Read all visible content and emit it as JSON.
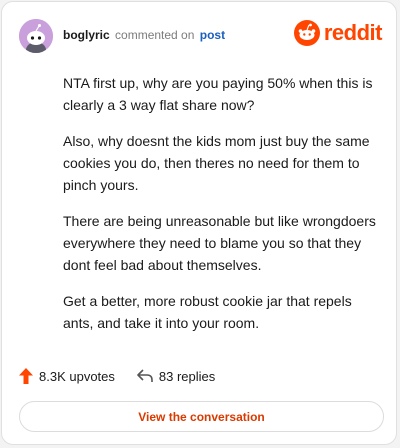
{
  "header": {
    "username": "boglyric",
    "action": "commented on",
    "post_link": "post"
  },
  "logo": {
    "text": "reddit",
    "icon": "reddit-snoo-icon",
    "color": "#ff4500"
  },
  "comment": {
    "paragraphs": [
      "NTA first up, why are you paying 50% when this is clearly a 3 way flat share now?",
      "Also, why doesnt the kids mom just buy the same cookies you do, then theres no need for them to pinch yours.",
      "There are being unreasonable but like wrongdoers everywhere they need to blame you so that they dont feel bad about themselves.",
      "Get a better, more robust cookie jar that repels ants, and take it into your room."
    ]
  },
  "stats": {
    "upvotes": "8.3K upvotes",
    "upvote_icon": "upvote-arrow-icon",
    "replies": "83 replies",
    "reply_icon": "reply-arrow-icon"
  },
  "cta": {
    "label": "View the conversation"
  },
  "colors": {
    "accent": "#ff4500",
    "link": "#1a5fbf",
    "cta_text": "#d93a00"
  }
}
